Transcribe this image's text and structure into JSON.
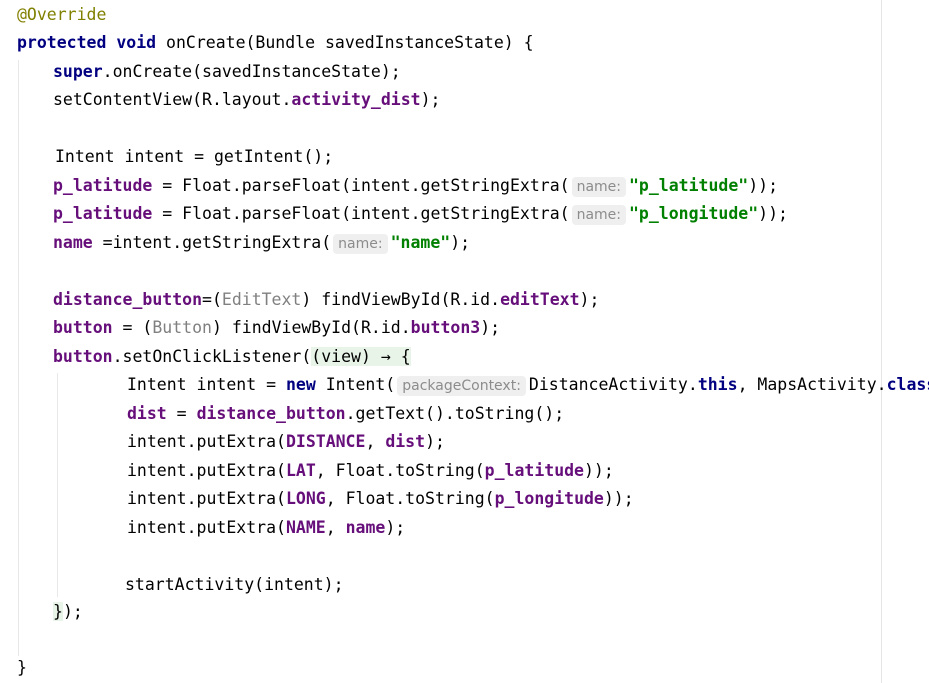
{
  "editor": {
    "lines": [
      {
        "tokens": [
          {
            "t": "@Override",
            "c": "annot"
          }
        ]
      },
      {
        "tokens": [
          {
            "t": "protected",
            "c": "kw"
          },
          {
            "t": " "
          },
          {
            "t": "void",
            "c": "kw"
          },
          {
            "t": " onCreate(Bundle savedInstanceState) {"
          }
        ]
      },
      {
        "tokens": [
          {
            "t": "super",
            "c": "kw"
          },
          {
            "t": ".onCreate(savedInstanceState);"
          }
        ]
      },
      {
        "tokens": [
          {
            "t": "setContentView(R.layout."
          },
          {
            "t": "activity_dist",
            "c": "field"
          },
          {
            "t": ");"
          }
        ]
      },
      {
        "tokens": []
      },
      {
        "tokens": [
          {
            "t": "Intent intent = getIntent();"
          }
        ]
      },
      {
        "tokens": [
          {
            "t": "p_latitude",
            "c": "field"
          },
          {
            "t": " = Float.parseFloat(intent.getStringExtra("
          },
          {
            "t": "name:",
            "c": "hint"
          },
          {
            "t": "\"p_latitude\"",
            "c": "str"
          },
          {
            "t": "));"
          }
        ]
      },
      {
        "tokens": [
          {
            "t": "p_latitude",
            "c": "field"
          },
          {
            "t": " = Float.parseFloat(intent.getStringExtra("
          },
          {
            "t": "name:",
            "c": "hint"
          },
          {
            "t": "\"p_longitude\"",
            "c": "str"
          },
          {
            "t": "));"
          }
        ]
      },
      {
        "tokens": [
          {
            "t": "name",
            "c": "field"
          },
          {
            "t": " =intent.getStringExtra("
          },
          {
            "t": "name:",
            "c": "hint"
          },
          {
            "t": "\"name\"",
            "c": "str"
          },
          {
            "t": ");"
          }
        ]
      },
      {
        "tokens": []
      },
      {
        "tokens": [
          {
            "t": "distance_button",
            "c": "field"
          },
          {
            "t": "=("
          },
          {
            "t": "EditText",
            "c": "cast"
          },
          {
            "t": ") findViewById(R.id."
          },
          {
            "t": "editText",
            "c": "field"
          },
          {
            "t": ");"
          }
        ]
      },
      {
        "tokens": [
          {
            "t": "button",
            "c": "field"
          },
          {
            "t": " = ("
          },
          {
            "t": "Button",
            "c": "cast"
          },
          {
            "t": ") findViewById(R.id."
          },
          {
            "t": "button3",
            "c": "field"
          },
          {
            "t": ");"
          }
        ]
      },
      {
        "tokens": [
          {
            "t": "button",
            "c": "field"
          },
          {
            "t": ".setOnClickListener("
          },
          {
            "t": "(view) → {",
            "c": "lambda"
          }
        ]
      },
      {
        "tokens": [
          {
            "t": "Intent intent = "
          },
          {
            "t": "new",
            "c": "kw"
          },
          {
            "t": " Intent("
          },
          {
            "t": "packageContext:",
            "c": "hint"
          },
          {
            "t": "DistanceActivity."
          },
          {
            "t": "this",
            "c": "kw"
          },
          {
            "t": ", MapsActivity."
          },
          {
            "t": "class",
            "c": "kw"
          },
          {
            "t": ");"
          }
        ]
      },
      {
        "tokens": [
          {
            "t": "dist",
            "c": "field"
          },
          {
            "t": " = "
          },
          {
            "t": "distance_button",
            "c": "field"
          },
          {
            "t": ".getText().toString();"
          }
        ]
      },
      {
        "tokens": [
          {
            "t": "intent.putExtra("
          },
          {
            "t": "DISTANCE",
            "c": "field"
          },
          {
            "t": ", "
          },
          {
            "t": "dist",
            "c": "field"
          },
          {
            "t": ");"
          }
        ]
      },
      {
        "tokens": [
          {
            "t": "intent.putExtra("
          },
          {
            "t": "LAT",
            "c": "field"
          },
          {
            "t": ", Float.toString("
          },
          {
            "t": "p_latitude",
            "c": "field"
          },
          {
            "t": "));"
          }
        ]
      },
      {
        "tokens": [
          {
            "t": "intent.putExtra("
          },
          {
            "t": "LONG",
            "c": "field"
          },
          {
            "t": ", Float.toString("
          },
          {
            "t": "p_longitude",
            "c": "field"
          },
          {
            "t": "));"
          }
        ]
      },
      {
        "tokens": [
          {
            "t": "intent.putExtra("
          },
          {
            "t": "NAME",
            "c": "field"
          },
          {
            "t": ", "
          },
          {
            "t": "name",
            "c": "field"
          },
          {
            "t": ");"
          }
        ]
      },
      {
        "tokens": []
      },
      {
        "tokens": [
          {
            "t": "startActivity(intent);"
          }
        ]
      },
      {
        "tokens": [
          {
            "t": "}",
            "c": "brace"
          },
          {
            "t": ");"
          }
        ]
      },
      {
        "tokens": []
      },
      {
        "tokens": [
          {
            "t": "}"
          }
        ]
      }
    ]
  }
}
